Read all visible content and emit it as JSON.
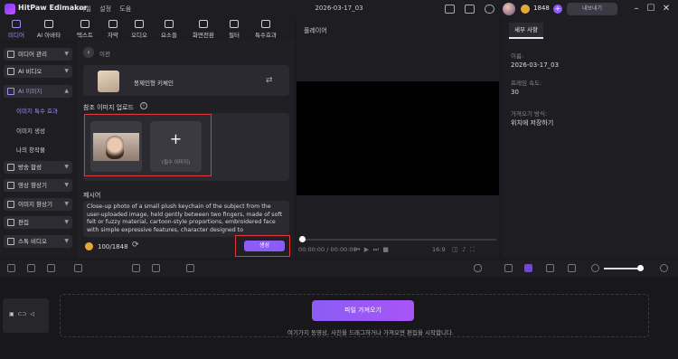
{
  "app": {
    "title": "HitPaw Edimakor",
    "menu": [
      "파일",
      "설정",
      "도움"
    ],
    "document_title": "2026-03-17_03"
  },
  "header": {
    "coins": "1848",
    "export_label": "내보내기",
    "plus_label": "+"
  },
  "tools": [
    "미디어",
    "AI 아바타",
    "텍스트",
    "자막",
    "오디오",
    "요소들",
    "화면전환",
    "필터",
    "특수효과"
  ],
  "sidebar": {
    "items": [
      "미디어 관리",
      "AI 비디오",
      "AI 이미지",
      "방송 합성",
      "영상 향상기",
      "이미지 향상기",
      "편집",
      "스톡 비디오"
    ],
    "subitems": [
      "이미지 특수 효과",
      "이미지 생성",
      "나의 창작물"
    ]
  },
  "effect_panel": {
    "back_label": "이전",
    "effect_name": "봉제인형 키체인",
    "ref_label": "참조 이미지 업로드",
    "add_label": "(필수 이미지)",
    "prompt_label": "제시어",
    "prompt_text": "Close-up photo of a small plush keychain of the subject from the user-uploaded image, held gently between two fingers, made of soft felt or fuzzy material, cartoon-style proportions, embroidered face with simple expressive features, character designed to",
    "credits": "100/1848",
    "generate_label": "생성"
  },
  "player": {
    "label": "플레이어",
    "time": "00:00:00 / 00:00:00",
    "ratio": "16:9",
    "progress": 0
  },
  "properties": {
    "tab": "세부 사항",
    "name_label": "이름:",
    "name_value": "2026-03-17_03",
    "fps_label": "프레임 속도:",
    "fps_value": "30",
    "import_label": "가져오기 방식:",
    "import_value": "위치에 저장하기"
  },
  "timeline": {
    "import_button": "파일 가져오기",
    "hint": "여기가지 동영상, 사진을 드래그하거나 가져오면 편집을 시작합니다."
  }
}
